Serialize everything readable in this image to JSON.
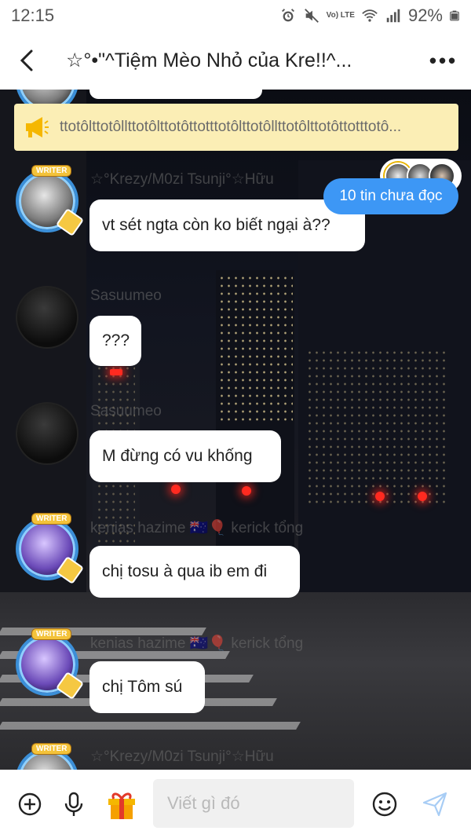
{
  "status_bar": {
    "time": "12:15",
    "battery": "92%",
    "network": "Vo) LTE",
    "icons": [
      "alarm-icon",
      "mute-icon",
      "volte-icon",
      "wifi-icon",
      "signal-icon",
      "battery-icon"
    ]
  },
  "header": {
    "back_icon": "back-arrow-icon",
    "title": "☆°•\"^Tiệm Mèo Nhỏ của Kre!!^...",
    "more_icon": "more-icon"
  },
  "pinned": {
    "icon": "megaphone-icon",
    "text": "ttotôlttotôllttotôlttotôttotttotôlttotôllttotôlttotôttotttotô..."
  },
  "online_users": {
    "count": 3
  },
  "messages": [
    {
      "nickname": "☆°Krezy/M0zi Tsunji°☆Hữu",
      "text": "vt sét ngta còn ko biết ngại à??",
      "avatar": "writer-knight-avatar"
    },
    {
      "nickname": "Sasuumeo",
      "text": "???",
      "avatar": "dark-avatar"
    },
    {
      "nickname": "Sasuumeo",
      "text": "M đừng có vu khống",
      "avatar": "dark-avatar"
    },
    {
      "nickname": "kenias hazime 🇦🇺🎈 kerick tổng",
      "text": "chị tosu à qua ib em đi",
      "avatar": "writer-purple-avatar"
    },
    {
      "nickname": "kenias hazime 🇦🇺🎈 kerick tổng",
      "text": "chị Tôm sú",
      "avatar": "writer-purple-avatar"
    },
    {
      "nickname": "☆°Krezy/M0zi Tsunji°☆Hữu",
      "text": "",
      "avatar": "writer-knight-avatar"
    }
  ],
  "badges": {
    "writer": "WRITER"
  },
  "unread_button": "10 tin chưa đọc",
  "input_bar": {
    "placeholder": "Viết gì đó",
    "icons": [
      "add-icon",
      "microphone-icon",
      "gift-icon",
      "emoji-icon",
      "send-icon"
    ]
  },
  "colors": {
    "accent": "#3d97f5",
    "pinned_bg": "#fbeeb5",
    "bubble_bg": "#ffffff",
    "writer_frame": "#3b8fd8"
  }
}
